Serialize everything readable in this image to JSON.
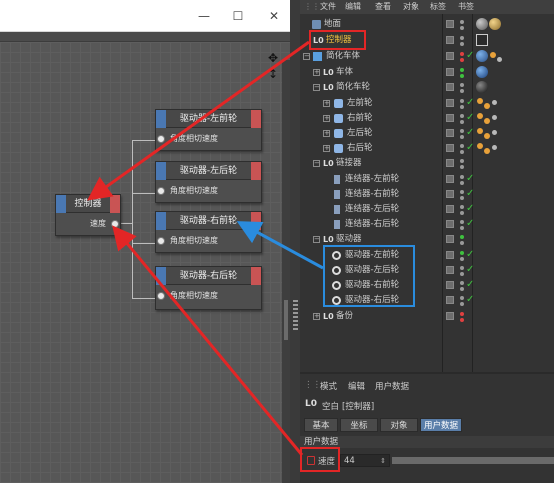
{
  "window_controls": {
    "minimize": "—",
    "maximize": "☐",
    "close": "✕"
  },
  "move_handle": "✥ ↕",
  "nodes": {
    "controller": {
      "title": "控制器",
      "port_label": "速度"
    },
    "drivers": [
      {
        "title": "驱动器-左前轮",
        "port_label": "角度相切速度"
      },
      {
        "title": "驱动器-左后轮",
        "port_label": "角度相切速度"
      },
      {
        "title": "驱动器-右前轮",
        "port_label": "角度相切速度"
      },
      {
        "title": "驱动器-右后轮",
        "port_label": "角度相切速度"
      }
    ]
  },
  "object_manager": {
    "menu": [
      "文件",
      "编辑",
      "查看",
      "对象",
      "标签",
      "书签"
    ],
    "rows": [
      {
        "name": "地面",
        "icon": "floor-icon"
      },
      {
        "name": "控制器",
        "icon": "null-object-icon"
      },
      {
        "name": "简化车体",
        "icon": "cube-icon"
      },
      {
        "name": "车体",
        "icon": "null-object-icon"
      },
      {
        "name": "简化车轮",
        "icon": "null-object-icon"
      },
      {
        "name": "左前轮",
        "icon": "cylinder-icon"
      },
      {
        "name": "右前轮",
        "icon": "cylinder-icon"
      },
      {
        "name": "左后轮",
        "icon": "cylinder-icon"
      },
      {
        "name": "右后轮",
        "icon": "cylinder-icon"
      },
      {
        "name": "链接器",
        "icon": "null-object-icon"
      },
      {
        "name": "连结器-左前轮",
        "icon": "connector-icon"
      },
      {
        "name": "连结器-右前轮",
        "icon": "connector-icon"
      },
      {
        "name": "连结器-左后轮",
        "icon": "connector-icon"
      },
      {
        "name": "连结器-右后轮",
        "icon": "connector-icon"
      },
      {
        "name": "驱动器",
        "icon": "null-object-icon"
      },
      {
        "name": "驱动器-左前轮",
        "icon": "motor-icon"
      },
      {
        "name": "驱动器-左后轮",
        "icon": "motor-icon"
      },
      {
        "name": "驱动器-右前轮",
        "icon": "motor-icon"
      },
      {
        "name": "驱动器-右后轮",
        "icon": "motor-icon"
      },
      {
        "name": "备份",
        "icon": "null-object-icon"
      }
    ]
  },
  "attribute_manager": {
    "menu": [
      "模式",
      "编辑",
      "用户数据"
    ],
    "object_type": "空白",
    "object_name": "[控制器]",
    "tabs": [
      "基本",
      "坐标",
      "对象",
      "用户数据"
    ],
    "active_tab": "用户数据",
    "section": "用户数据",
    "field_label": "速度",
    "field_value": "44"
  },
  "colors": {
    "annotation_red": "#e32626",
    "annotation_blue": "#2a8cde",
    "port_blue": "#4a78b3",
    "port_red": "#c95454"
  }
}
